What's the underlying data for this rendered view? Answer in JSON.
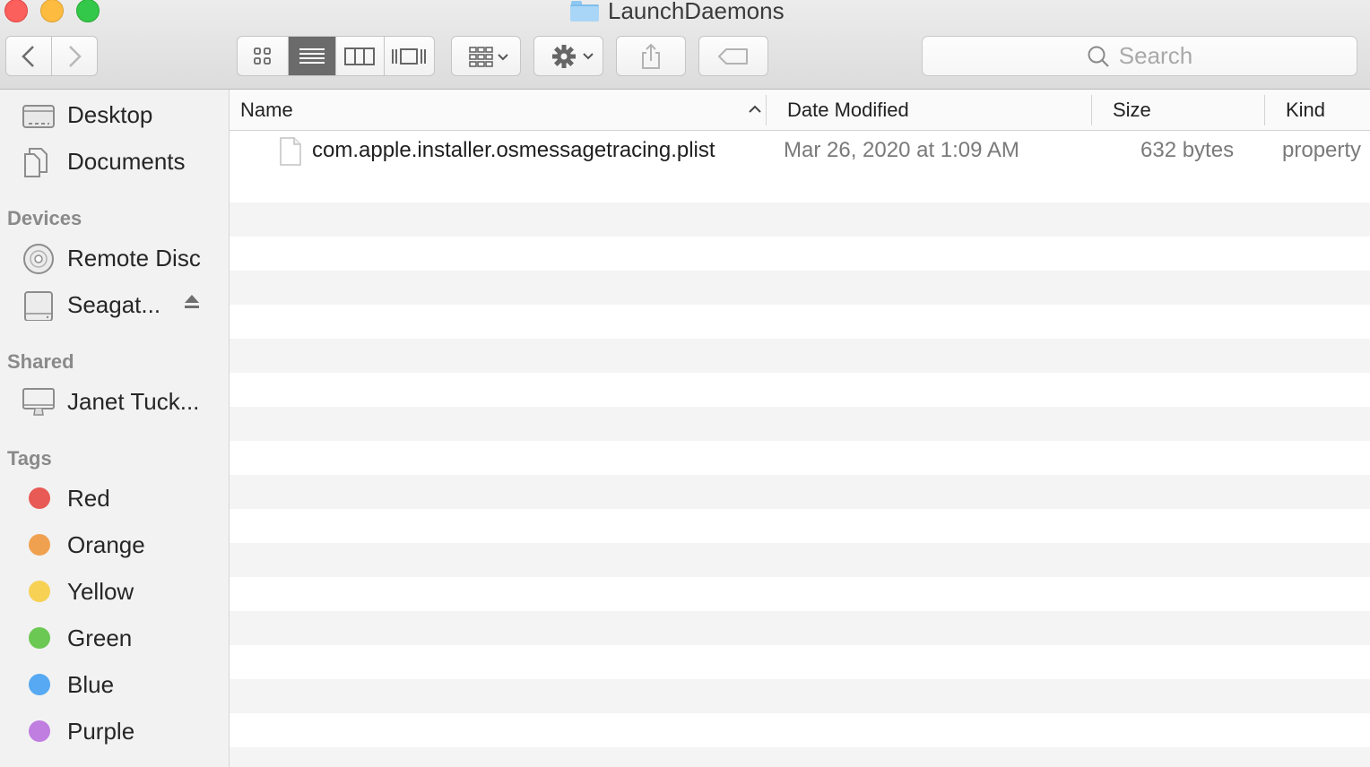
{
  "window": {
    "title": "LaunchDaemons"
  },
  "toolbar": {
    "back_icon": "chevron-left-icon",
    "forward_icon": "chevron-right-icon",
    "view_modes": [
      "icon-view",
      "list-view",
      "column-view",
      "cover-flow-view"
    ],
    "active_view": "list-view",
    "search_placeholder": "Search"
  },
  "sidebar": {
    "favorites": [
      {
        "label": "Desktop",
        "icon": "desktop-icon"
      },
      {
        "label": "Documents",
        "icon": "documents-icon"
      }
    ],
    "devices_heading": "Devices",
    "devices": [
      {
        "label": "Remote Disc",
        "icon": "disc-icon"
      },
      {
        "label": "Seagat...",
        "icon": "drive-icon",
        "ejectable": true
      }
    ],
    "shared_heading": "Shared",
    "shared": [
      {
        "label": "Janet Tuck...",
        "icon": "computer-icon"
      }
    ],
    "tags_heading": "Tags",
    "tags": [
      {
        "label": "Red",
        "color": "#e85a55"
      },
      {
        "label": "Orange",
        "color": "#f0a150"
      },
      {
        "label": "Yellow",
        "color": "#f6d154"
      },
      {
        "label": "Green",
        "color": "#6bc852"
      },
      {
        "label": "Blue",
        "color": "#56a9f2"
      },
      {
        "label": "Purple",
        "color": "#c07ee0"
      }
    ]
  },
  "columns": {
    "name": "Name",
    "date_modified": "Date Modified",
    "size": "Size",
    "kind": "Kind",
    "sort_indicator": "chevron-up-icon"
  },
  "files": [
    {
      "name": "com.apple.installer.osmessagetracing.plist",
      "date_modified": "Mar 26, 2020 at 1:09 AM",
      "size": "632 bytes",
      "kind": "property"
    }
  ]
}
